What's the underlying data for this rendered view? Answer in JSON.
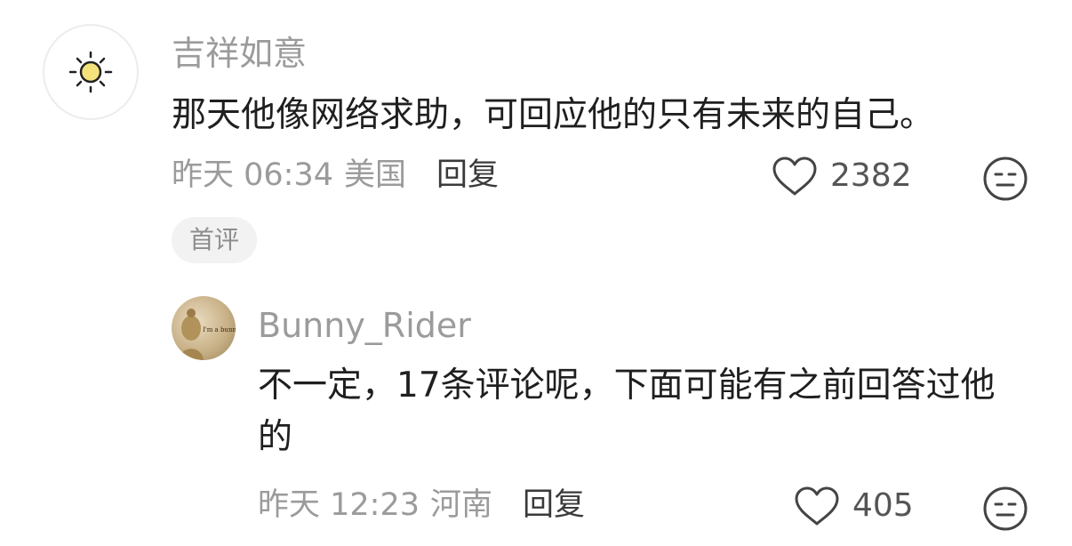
{
  "comment": {
    "username": "吉祥如意",
    "text": "那天他像网络求助，可回应他的只有未来的自己。",
    "time": "昨天 06:34",
    "location": "美国",
    "reply_label": "回复",
    "likes": "2382",
    "badge": "首评",
    "avatar_icon": "sun-icon"
  },
  "reply": {
    "username": "Bunny_Rider",
    "text": "不一定，17条评论呢，下面可能有之前回答过他的",
    "time": "昨天 12:23",
    "location": "河南",
    "reply_label": "回复",
    "likes": "405",
    "avatar_text": "I'm a bunny",
    "avatar_icon": "buddha-statue-icon"
  },
  "icons": {
    "like": "heart-outline-icon",
    "dislike": "meh-face-icon"
  },
  "colors": {
    "username": "#9b9b9b",
    "text": "#1f1f1f",
    "meta": "#9b9b9b",
    "reply_action": "#3a3a3a",
    "badge_bg": "#f2f2f2",
    "sun": "#f5e27a"
  }
}
